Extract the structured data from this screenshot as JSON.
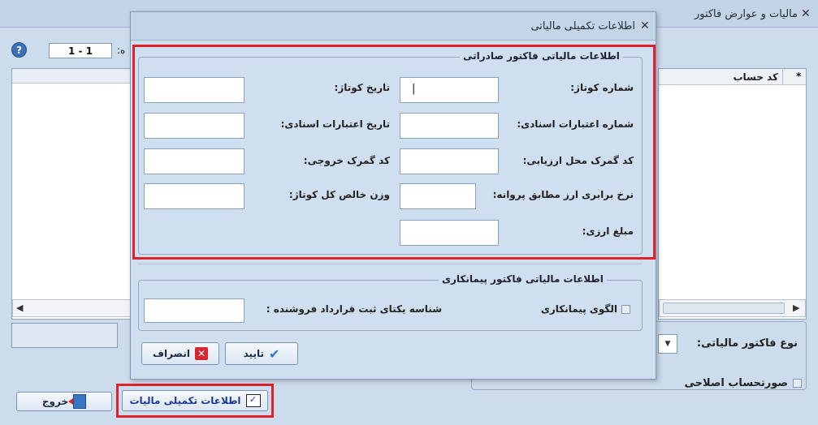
{
  "main_window": {
    "title": "ماليات و عوارض فاکتور",
    "page_indicator": "1 - 1",
    "page_suffix": ":ه",
    "help_symbol": "?",
    "column_account_code": "کد حساب",
    "column_marker": "*",
    "tax_invoice_type_label": "نوع فاکتور مالیاتی:",
    "corrective_invoice_label": "صورتحساب اصلاحی",
    "exit_button": "خروج",
    "extra_tax_info_button": "اطلاعات تکمیلی مالیات"
  },
  "dialog": {
    "title": "اطلاعات تکمیلی مالیاتی",
    "export_group": {
      "legend": "اطلاعات مالیاتی فاکتور صادراتی",
      "fields": {
        "cotage_number": "شماره کوتاژ:",
        "cotage_date": "تاریخ کوتاژ:",
        "doc_credit_number": "شماره اعتبارات اسنادی:",
        "doc_credit_date": "تاریخ اعتبارات اسنادی:",
        "customs_eval_code": "کد گمرک محل ارزیابی:",
        "exit_customs_code": "کد گمرک خروجی:",
        "exchange_rate": "نرخ برابری ارز مطابق پروانه:",
        "net_weight": "وزن خالص کل کوتاژ:",
        "currency_amount": "مبلغ ارزی:"
      },
      "cotage_number_value": "|"
    },
    "contract_group": {
      "legend": "اطلاعات مالیاتی فاکتور پیمانکاری",
      "contract_pattern_label": "الگوی پیمانکاری",
      "seller_contract_id_label": "شناسه یکتای ثبت قرارداد فروشنده :"
    },
    "confirm_button": "تایید",
    "cancel_button": "انصراف"
  },
  "colors": {
    "highlight": "#e0202b",
    "window_bg": "#cddcec",
    "group_bg": "#cfdff0"
  }
}
